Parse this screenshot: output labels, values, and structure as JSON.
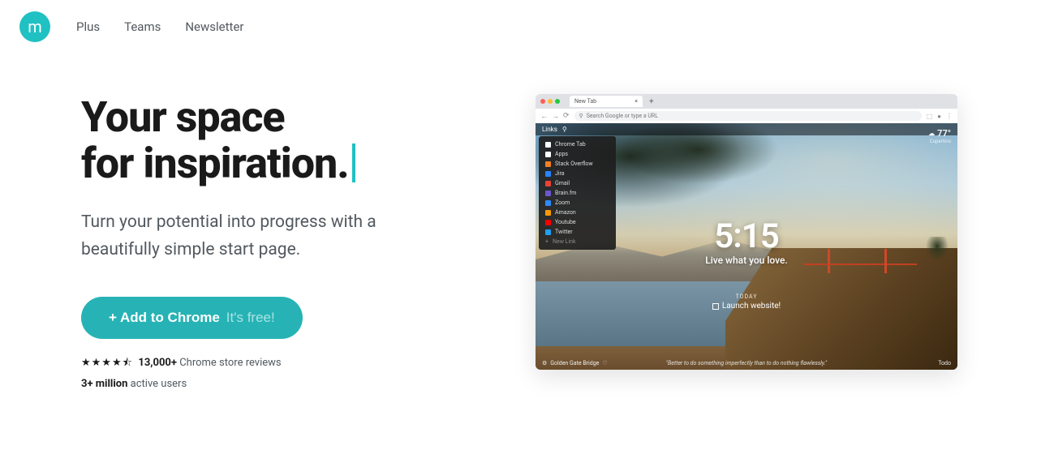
{
  "nav": {
    "logo_letter": "m",
    "items": [
      "Plus",
      "Teams",
      "Newsletter"
    ]
  },
  "hero": {
    "title_line1": "Your space",
    "title_line2": "for inspiration.",
    "subtitle": "Turn your potential into progress with a beautifully simple start page.",
    "cta_label": "+ Add to Chrome",
    "cta_free": "It's free!",
    "stars_display": "★★★★⯪",
    "reviews_count": "13,000+",
    "reviews_text": "Chrome store reviews",
    "active_users_count": "3+ million",
    "active_users_text": "active users"
  },
  "preview": {
    "tab_name": "New Tab",
    "url_placeholder": "Search Google or type a URL",
    "links_label": "Links",
    "links": [
      {
        "name": "Chrome Tab",
        "color": "#ffffff"
      },
      {
        "name": "Apps",
        "color": "#ffffff"
      },
      {
        "name": "Stack Overflow",
        "color": "#f48024"
      },
      {
        "name": "Jira",
        "color": "#2684ff"
      },
      {
        "name": "Gmail",
        "color": "#ea4335"
      },
      {
        "name": "Brain.fm",
        "color": "#6e56cf"
      },
      {
        "name": "Zoom",
        "color": "#2d8cff"
      },
      {
        "name": "Amazon",
        "color": "#ff9900"
      },
      {
        "name": "Youtube",
        "color": "#ff0000"
      },
      {
        "name": "Twitter",
        "color": "#1da1f2"
      }
    ],
    "new_link": "New Link",
    "weather_temp": "77°",
    "weather_loc": "Cupertino",
    "time": "5:15",
    "mantra": "Live what you love.",
    "today_label": "TODAY",
    "todo_text": "Launch website!",
    "photo_credit": "Golden Gate Bridge",
    "quote": "\"Better to do something imperfectly than to do nothing flawlessly.\"",
    "footer_right": "Todo"
  }
}
